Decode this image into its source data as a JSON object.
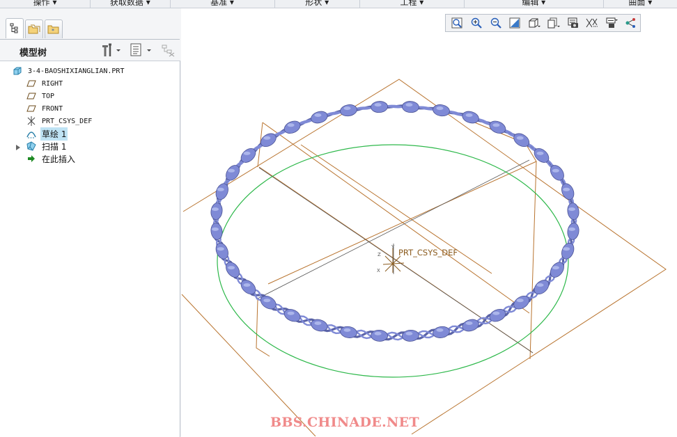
{
  "ribbon": {
    "groups": [
      "操作 ▾",
      "获取数据 ▾",
      "基准 ▾",
      "形状 ▾",
      "工程 ▾",
      "编辑 ▾",
      "曲面 ▾"
    ]
  },
  "left_panel": {
    "tabs": [
      {
        "name": "model-tree-tab",
        "icon": "tree-icon",
        "active": true
      },
      {
        "name": "folder-browser-tab",
        "icon": "folder-icon",
        "active": false
      },
      {
        "name": "favorites-tab",
        "icon": "favorites-folder-icon",
        "active": false
      }
    ],
    "tree_title": "模型树",
    "tree_items": [
      {
        "label": "3-4-BAOSHIXIANGLIAN.PRT",
        "icon": "part-icon"
      },
      {
        "label": "RIGHT",
        "icon": "datum-plane-icon"
      },
      {
        "label": "TOP",
        "icon": "datum-plane-icon"
      },
      {
        "label": "FRONT",
        "icon": "datum-plane-icon"
      },
      {
        "label": "PRT_CSYS_DEF",
        "icon": "csys-icon"
      },
      {
        "label": "草绘 1",
        "icon": "sketch-icon",
        "selected": true
      },
      {
        "label": "扫描 1",
        "icon": "sweep-icon",
        "expandable": true
      },
      {
        "label": "在此插入",
        "icon": "insert-here-arrow-icon"
      }
    ]
  },
  "view_toolbar": {
    "buttons": [
      "refit-icon",
      "zoom-in-icon",
      "zoom-out-icon",
      "repaint-icon",
      "display-style-icon",
      "saved-views-icon",
      "view-manager-icon",
      "datum-display-icon",
      "annotation-display-icon",
      "spin-center-icon"
    ]
  },
  "graphics": {
    "csys_label": "PRT_CSYS_DEF",
    "watermark": "BBS.CHINADE.NET",
    "colors": {
      "datum": "#b8732e",
      "sketch": "#2db84a",
      "model": "#7f8ad6"
    }
  }
}
